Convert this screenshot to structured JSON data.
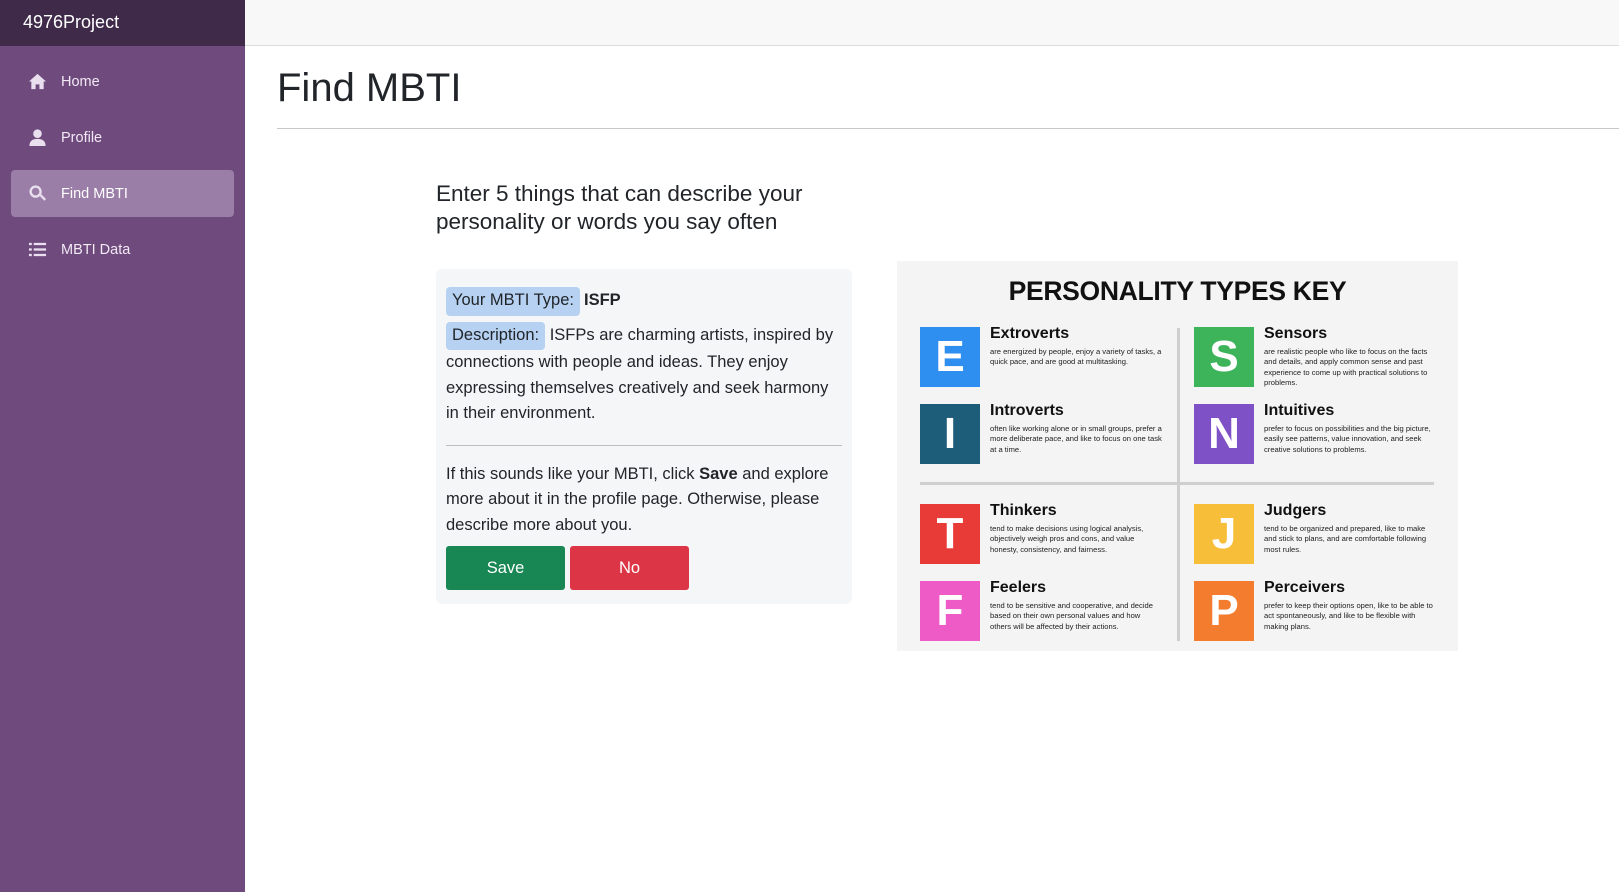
{
  "brand": "4976Project",
  "sidebar": {
    "items": [
      {
        "label": "Home",
        "icon": "home-icon"
      },
      {
        "label": "Profile",
        "icon": "user-icon"
      },
      {
        "label": "Find MBTI",
        "icon": "search-icon",
        "active": true
      },
      {
        "label": "MBTI Data",
        "icon": "list-icon"
      }
    ]
  },
  "main": {
    "title": "Find MBTI",
    "prompt": "Enter 5 things that can describe your personality or words you say often",
    "result": {
      "type_label": "Your MBTI Type:",
      "type_value": "ISFP",
      "description_label": "Description:",
      "description_text": "ISFPs are charming artists, inspired by connections with people and ideas. They enjoy expressing themselves creatively and seek harmony in their environment.",
      "advice_prefix": "If this sounds like your MBTI, click",
      "advice_bold": "Save",
      "advice_suffix": "and explore more about it in the profile page. Otherwise, please describe more about you.",
      "save_label": "Save",
      "no_label": "No"
    }
  },
  "key": {
    "title": "PERSONALITY TYPES KEY",
    "traits": [
      {
        "letter": "E",
        "name": "Extroverts",
        "desc": "are energized by people, enjoy a variety of tasks, a quick pace, and are good at multitasking.",
        "color": "#2f8ff0"
      },
      {
        "letter": "S",
        "name": "Sensors",
        "desc": "are realistic people who like to focus on the facts and details, and apply common sense and past experience to come up with practical solutions to problems.",
        "color": "#3db35a"
      },
      {
        "letter": "I",
        "name": "Introverts",
        "desc": "often like working alone or in small groups, prefer a more deliberate pace, and like to focus on one task at a time.",
        "color": "#1d5d7a"
      },
      {
        "letter": "N",
        "name": "Intuitives",
        "desc": "prefer to focus on possibilities and the big picture, easily see patterns, value innovation, and seek creative solutions to problems.",
        "color": "#7e52c6"
      },
      {
        "letter": "T",
        "name": "Thinkers",
        "desc": "tend to make decisions using logical analysis, objectively weigh pros and cons, and value honesty, consistency, and fairness.",
        "color": "#e83a36"
      },
      {
        "letter": "J",
        "name": "Judgers",
        "desc": "tend to be organized and prepared, like to make and stick to plans, and are comfortable following most rules.",
        "color": "#f7be3a"
      },
      {
        "letter": "F",
        "name": "Feelers",
        "desc": "tend to be sensitive and cooperative, and decide based on their own personal values and how others will be affected by their actions.",
        "color": "#ef5bc6"
      },
      {
        "letter": "P",
        "name": "Perceivers",
        "desc": "prefer to keep their options open, like to be able to act spontaneously, and like to be flexible with making plans.",
        "color": "#f37c2e"
      }
    ]
  }
}
